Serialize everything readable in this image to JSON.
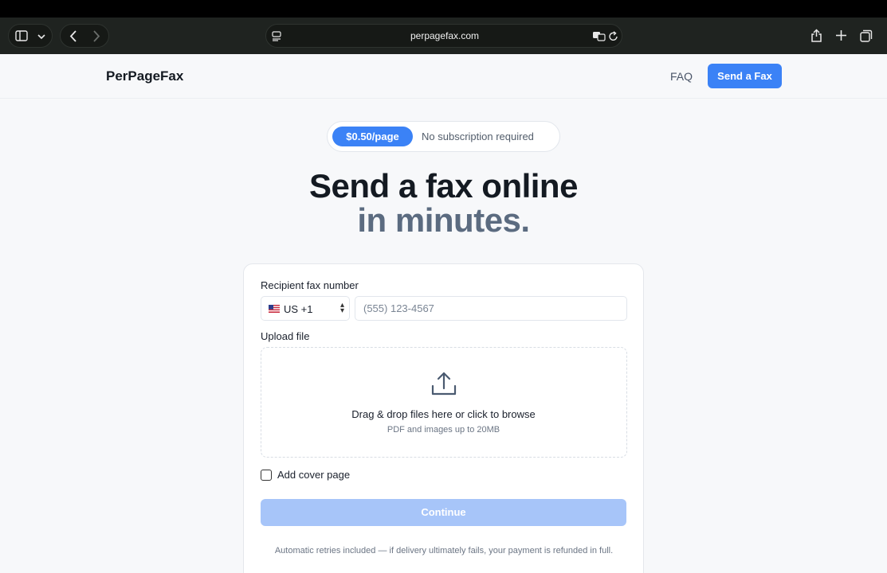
{
  "browser": {
    "url": "perpagefax.com",
    "icons": [
      "sidebar-icon",
      "chevron-down-icon",
      "back-icon",
      "forward-icon",
      "site-settings-icon",
      "translate-icon",
      "reload-icon",
      "share-icon",
      "new-tab-icon",
      "tabs-overview-icon"
    ]
  },
  "header": {
    "logo": "PerPageFax",
    "faq_label": "FAQ",
    "send_label": "Send a Fax"
  },
  "badge": {
    "price": "$0.50/page",
    "text": "No subscription required"
  },
  "hero": {
    "line1": "Send a fax online",
    "line2": "in minutes."
  },
  "form": {
    "recipient_label": "Recipient fax number",
    "country_value": "US +1",
    "phone_placeholder": "(555) 123-4567",
    "upload_label": "Upload file",
    "drop_title": "Drag & drop files here or click to browse",
    "drop_sub": "PDF and images up to 20MB",
    "cover_label": "Add cover page",
    "cover_checked": false,
    "continue_label": "Continue",
    "note": "Automatic retries included — if delivery ultimately fails, your payment is refunded in full."
  },
  "colors": {
    "accent": "#3b82f6",
    "accent_disabled": "#a7c5f9",
    "heading": "#141a22",
    "heading_muted": "#5b6b80"
  }
}
